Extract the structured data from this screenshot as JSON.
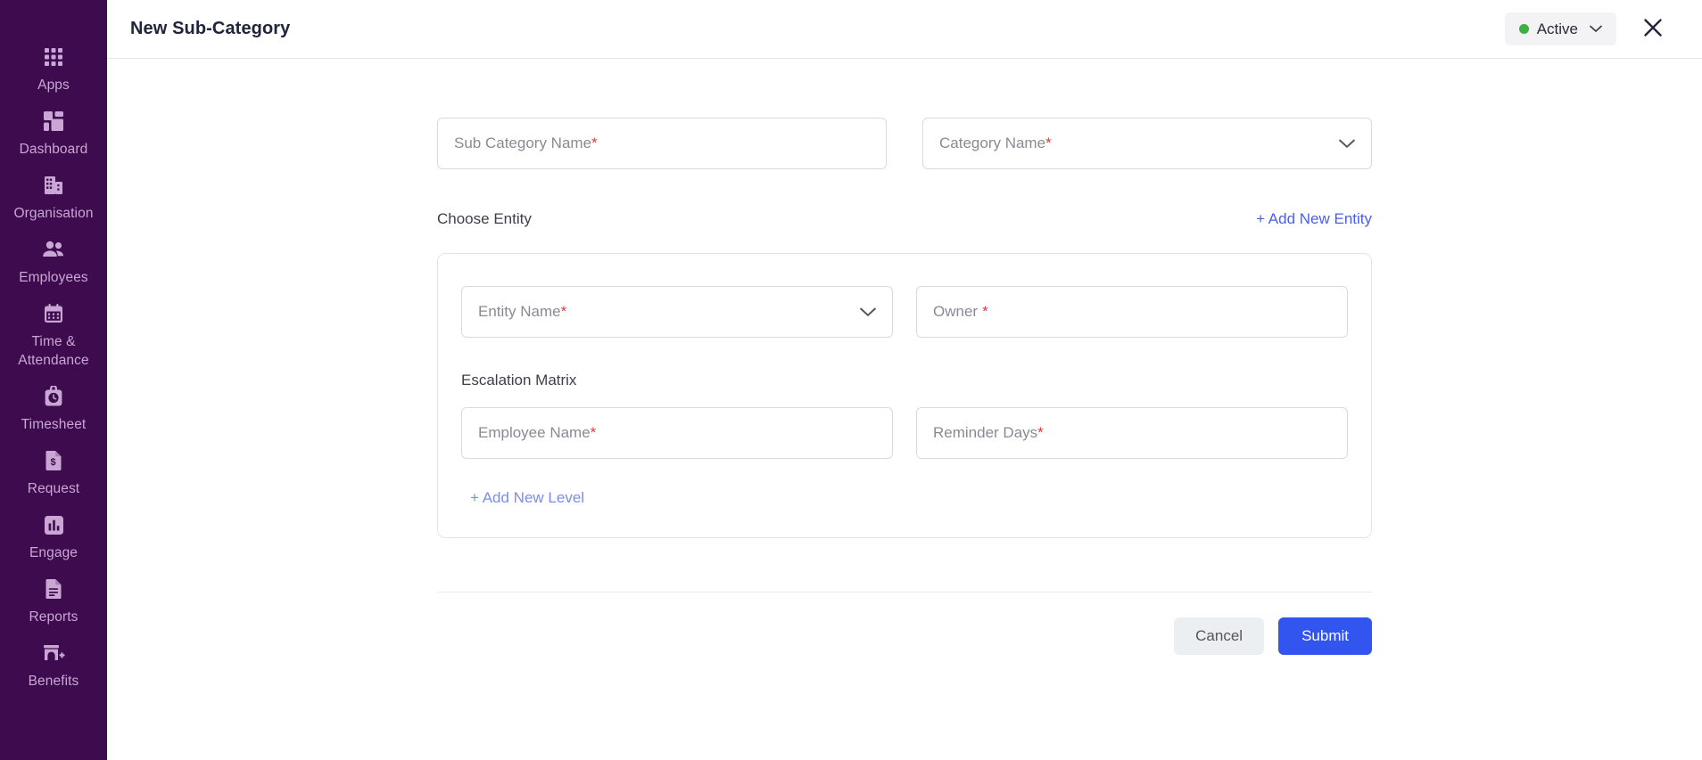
{
  "sidebar": {
    "items": [
      {
        "label": "Apps",
        "icon": "apps-grid-icon"
      },
      {
        "label": "Dashboard",
        "icon": "dashboard-icon"
      },
      {
        "label": "Organisation",
        "icon": "building-icon"
      },
      {
        "label": "Employees",
        "icon": "people-icon"
      },
      {
        "label": "Time & Attendance",
        "icon": "calendar-icon"
      },
      {
        "label": "Timesheet",
        "icon": "clock-bag-icon"
      },
      {
        "label": "Request",
        "icon": "document-dollar-icon"
      },
      {
        "label": "Engage",
        "icon": "bar-chart-icon"
      },
      {
        "label": "Reports",
        "icon": "document-lines-icon"
      },
      {
        "label": "Benefits",
        "icon": "store-plus-icon"
      }
    ]
  },
  "header": {
    "title": "New Sub-Category",
    "status": {
      "label": "Active",
      "dot_color": "#3cb043",
      "chevron": "chevron-down-icon"
    },
    "close": "close-icon"
  },
  "form": {
    "sub_category_name": {
      "placeholder": "Sub Category Name",
      "value": "",
      "required_mark": "*"
    },
    "category_name": {
      "placeholder": "Category Name",
      "value": "",
      "required_mark": "*",
      "chevron": "chevron-down-icon"
    },
    "choose_entity_label": "Choose Entity",
    "add_new_entity_label": "+ Add New Entity",
    "entity_card": {
      "entity_name": {
        "placeholder": "Entity Name",
        "value": "",
        "required_mark": "*",
        "chevron": "chevron-down-icon"
      },
      "owner": {
        "placeholder": "Owner",
        "value": "",
        "required_mark": "*"
      },
      "escalation_matrix_label": "Escalation Matrix",
      "employee_name": {
        "placeholder": "Employee Name",
        "value": "",
        "required_mark": "*"
      },
      "reminder_days": {
        "placeholder": "Reminder Days",
        "value": "",
        "required_mark": "*"
      },
      "add_new_level_label": "+ Add New Level"
    }
  },
  "footer": {
    "cancel_label": "Cancel",
    "submit_label": "Submit"
  },
  "colors": {
    "sidebar_bg": "#3d0b4e",
    "accent_blue": "#3355ef",
    "link_blue": "#4b61dd",
    "link_light_blue": "#7b8cf0",
    "required_red": "#e0393e",
    "status_green": "#3cb043"
  }
}
